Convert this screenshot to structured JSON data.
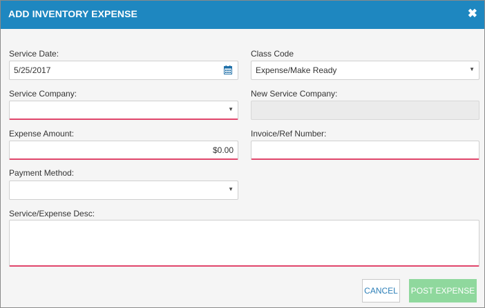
{
  "dialog": {
    "title": "ADD INVENTORY EXPENSE",
    "close_glyph": "✖"
  },
  "fields": {
    "service_date": {
      "label": "Service Date:",
      "value": "5/25/2017",
      "icon": "calendar-icon"
    },
    "class_code": {
      "label": "Class Code",
      "value": "Expense/Make Ready"
    },
    "service_company": {
      "label": "Service Company:",
      "value": ""
    },
    "new_service_company": {
      "label": "New Service Company:",
      "value": ""
    },
    "expense_amount": {
      "label": "Expense Amount:",
      "value": "$0.00"
    },
    "invoice_ref": {
      "label": "Invoice/Ref Number:",
      "value": ""
    },
    "payment_method": {
      "label": "Payment Method:",
      "value": ""
    },
    "description": {
      "label": "Service/Expense Desc:",
      "value": ""
    }
  },
  "buttons": {
    "cancel": "CANCEL",
    "post": "POST EXPENSE"
  },
  "colors": {
    "header": "#1e87c0",
    "required_border": "#e0446a",
    "post_button": "#8fd89d",
    "cancel_text": "#2c7fb8"
  }
}
